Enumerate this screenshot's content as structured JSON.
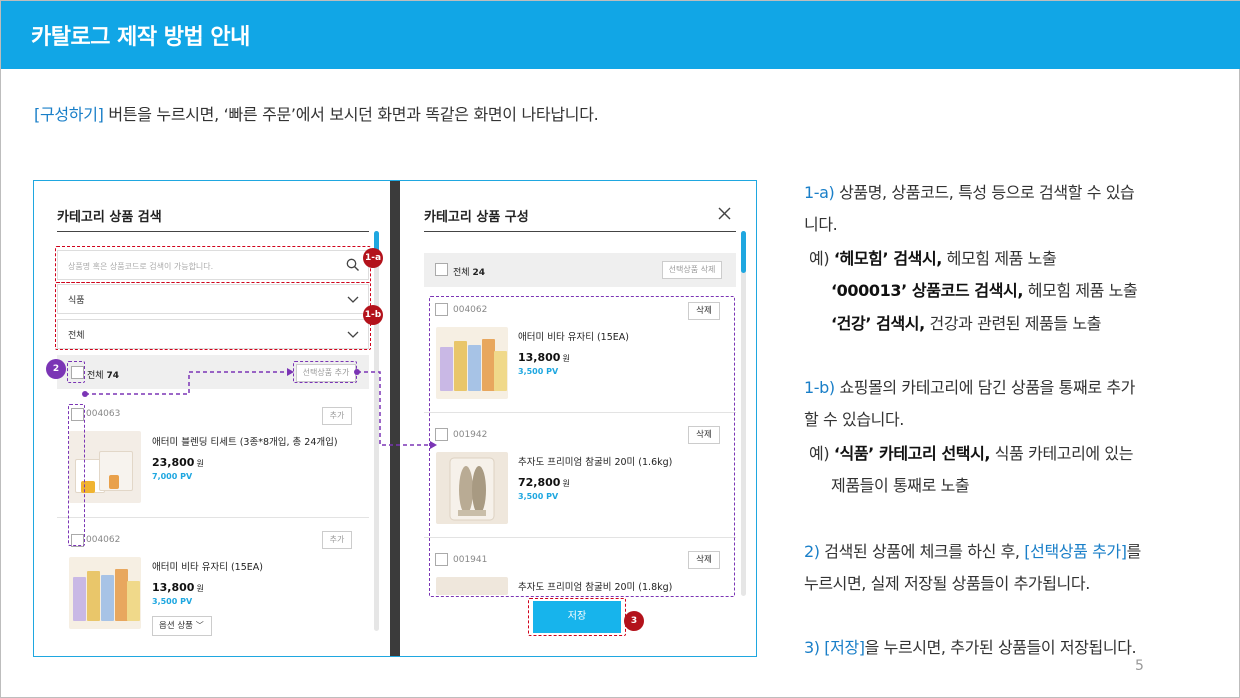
{
  "header": {
    "title": "카탈로그 제작 방법 안내"
  },
  "intro": {
    "highlight": "[구성하기]",
    "rest": " 버튼을 누르시면, ‘빠른 주문’에서 보시던 화면과 똑같은 화면이 나타납니다."
  },
  "left_panel": {
    "title": "카테고리 상품 검색",
    "search_placeholder": "상품명 혹은 상품코드로 검색이 가능합니다.",
    "category_select": "식품",
    "sub_select": "전체",
    "list_header_label": "전체",
    "list_header_count": "74",
    "add_selected_label": "선택상품 추가",
    "products": [
      {
        "code": "004063",
        "name": "애터미 블렌딩 티세트 (3종*8개입, 총 24개입)",
        "price": "23,800",
        "unit": "원",
        "pv": "7,000 PV",
        "add_label": "추가"
      },
      {
        "code": "004062",
        "name": "애터미 비타 유자티 (15EA)",
        "price": "13,800",
        "unit": "원",
        "pv": "3,500 PV",
        "add_label": "추가",
        "option_label": "옵션 상품"
      }
    ]
  },
  "right_panel": {
    "title": "카테고리 상품 구성",
    "list_header_label": "전체",
    "list_header_count": "24",
    "delete_selected_label": "선택상품 삭제",
    "products": [
      {
        "code": "004062",
        "name": "애터미 비타 유자티 (15EA)",
        "price": "13,800",
        "unit": "원",
        "pv": "3,500 PV",
        "delete_label": "삭제"
      },
      {
        "code": "001942",
        "name": "추자도 프리미엄 참굴비 20미 (1.6kg)",
        "price": "72,800",
        "unit": "원",
        "pv": "3,500 PV",
        "delete_label": "삭제"
      },
      {
        "code": "001941",
        "name": "추자도 프리미엄 참굴비 20미 (1.8kg)",
        "delete_label": "삭제"
      }
    ],
    "save_label": "저장"
  },
  "badges": {
    "b1a": "1-a",
    "b1b": "1-b",
    "b2": "2",
    "b3": "3"
  },
  "description": {
    "p1_line1_hl": "1-a)",
    "p1_line1": " 상품명, 상품코드, 특성 등으로 검색할 수 있습",
    "p1_line2": "니다.",
    "ex1_prefix": "예) ",
    "ex1_bold": "‘헤모힘’ 검색시,",
    "ex1_rest": " 헤모힘 제품 노출",
    "ex2_bold": "‘000013’ 상품코드 검색시,",
    "ex2_rest": " 헤모힘 제품 노출",
    "ex3_bold": "‘건강’ 검색시,",
    "ex3_rest": " 건강과 관련된 제품들 노출",
    "p2_line1_hl": "1-b)",
    "p2_line1": " 쇼핑몰의 카테고리에 담긴 상품을 통째로 추가",
    "p2_line2": "할 수 있습니다.",
    "ex4_prefix": "예) ",
    "ex4_bold": "‘식품’ 카테고리 선택시,",
    "ex4_rest": " 식품 카테고리에 있는",
    "ex4_line2": "제품들이 통째로 노출",
    "p3_hl": "2)",
    "p3_mid": " 검색된 상품에 체크를 하신 후, ",
    "p3_hl2": "[선택상품 추가]",
    "p3_end": "를",
    "p3_line2": "누르시면, 실제 저장될 상품들이 추가됩니다.",
    "p4_hl": "3) [저장]",
    "p4_rest": "을 누르시면, 추가된 상품들이 저장됩니다."
  },
  "page_number": "5",
  "colors": {
    "accent": "#11a6e6",
    "highlight_text": "#1a7fc8",
    "red_marker": "#b3121b",
    "purple_marker": "#7b35b5"
  }
}
